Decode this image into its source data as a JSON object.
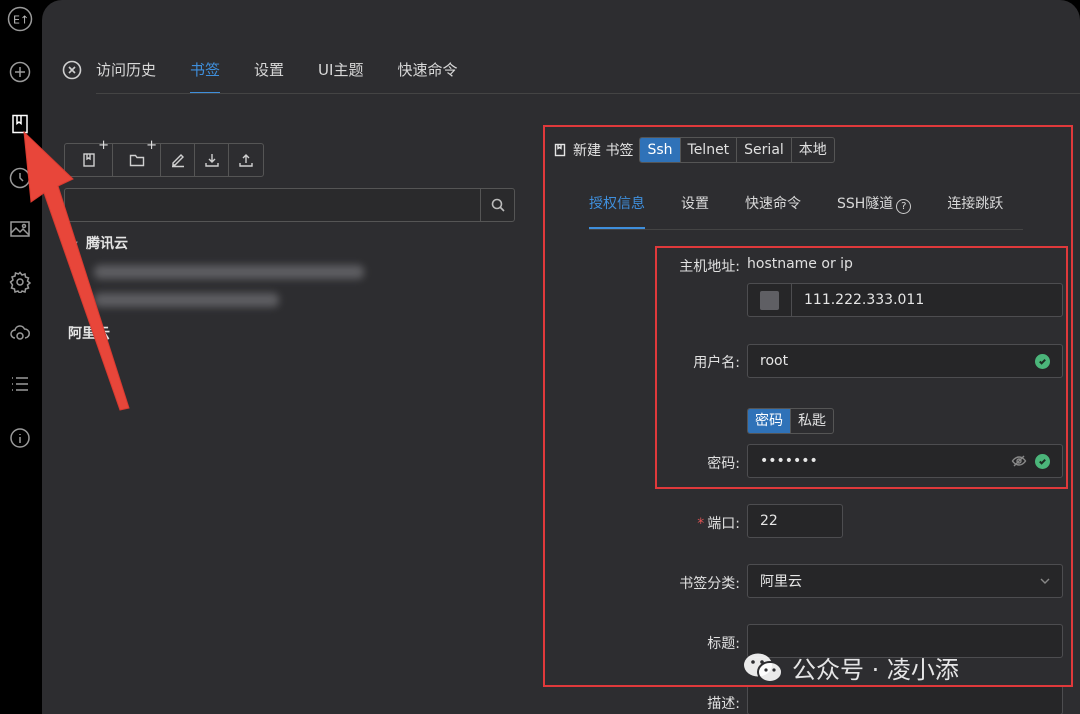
{
  "sidebar": {
    "logo_text": "E↑",
    "icons": [
      "logo-icon",
      "add-circle-icon",
      "bookmark-icon",
      "history-icon",
      "image-icon",
      "settings-icon",
      "cloud-sync-icon",
      "list-icon",
      "info-icon"
    ]
  },
  "top_tabs": [
    "访问历史",
    "书签",
    "设置",
    "UI主题",
    "快速命令"
  ],
  "tree": {
    "group1": "腾讯云",
    "group2": "阿里云"
  },
  "form": {
    "new_bookmark_label": "新建 书签",
    "types": [
      "Ssh",
      "Telnet",
      "Serial",
      "本地"
    ],
    "sub_tabs": [
      "授权信息",
      "设置",
      "快速命令",
      "SSH隧道",
      "连接跳跃"
    ],
    "host_label": "主机地址:",
    "host_hint": "hostname or ip",
    "host_value": "111.222.333.011",
    "username_label": "用户名:",
    "username_value": "root",
    "auth_types": [
      "密码",
      "私匙"
    ],
    "password_label": "密码:",
    "password_value": "•••••••",
    "port_label": "端口:",
    "port_value": "22",
    "category_label": "书签分类:",
    "category_value": "阿里云",
    "title_label": "标题:",
    "desc_label": "描述:"
  },
  "watermark": {
    "text": "公众号 · 凌小添"
  },
  "colors": {
    "accent": "#3f8fdc",
    "annotation_red": "#e0393b",
    "success": "#4bb57a"
  }
}
